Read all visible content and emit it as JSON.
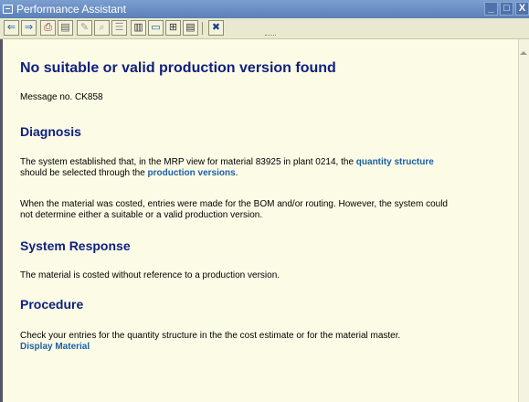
{
  "window": {
    "title": "Performance Assistant",
    "controls": [
      "_",
      "□",
      "X"
    ]
  },
  "toolbar": {
    "buttons": [
      {
        "name": "back-icon",
        "glyph": "⇐"
      },
      {
        "name": "forward-icon",
        "glyph": "⇒"
      },
      {
        "name": "print-icon",
        "glyph": "⎙"
      },
      {
        "name": "technical-info-icon",
        "glyph": "▤"
      },
      {
        "name": "edit-icon",
        "glyph": "✎"
      },
      {
        "name": "find-icon",
        "glyph": "⌕"
      },
      {
        "name": "sound-icon",
        "glyph": "☰"
      },
      {
        "name": "book-icon",
        "glyph": "▥"
      },
      {
        "name": "message-icon",
        "glyph": "▭"
      },
      {
        "name": "tree-icon",
        "glyph": "⊞"
      },
      {
        "name": "save-icon",
        "glyph": "▤"
      },
      {
        "name": "close-icon",
        "glyph": "✖"
      }
    ]
  },
  "document": {
    "title": "No suitable or valid production version found",
    "message_no": "Message no. CK858",
    "diagnosis": {
      "heading": "Diagnosis",
      "p1_prefix": "The system established that, in the MRP view for material 83925 in plant 0214, the ",
      "p1_link1": "quantity structure",
      "p1_mid": "should be selected through the ",
      "p1_link2": "production versions",
      "p1_suffix": ".",
      "p2_line1": "When the material was costed, entries were made for the BOM and/or routing. However, the system could",
      "p2_line2": "not determine either a suitable or a valid production version."
    },
    "system_response": {
      "heading": "System Response",
      "text": "The material is costed without reference to a production version."
    },
    "procedure": {
      "heading": "Procedure",
      "text": "Check your entries for the quantity structure in the the cost estimate or for the material master.",
      "link": "Display Material"
    }
  }
}
